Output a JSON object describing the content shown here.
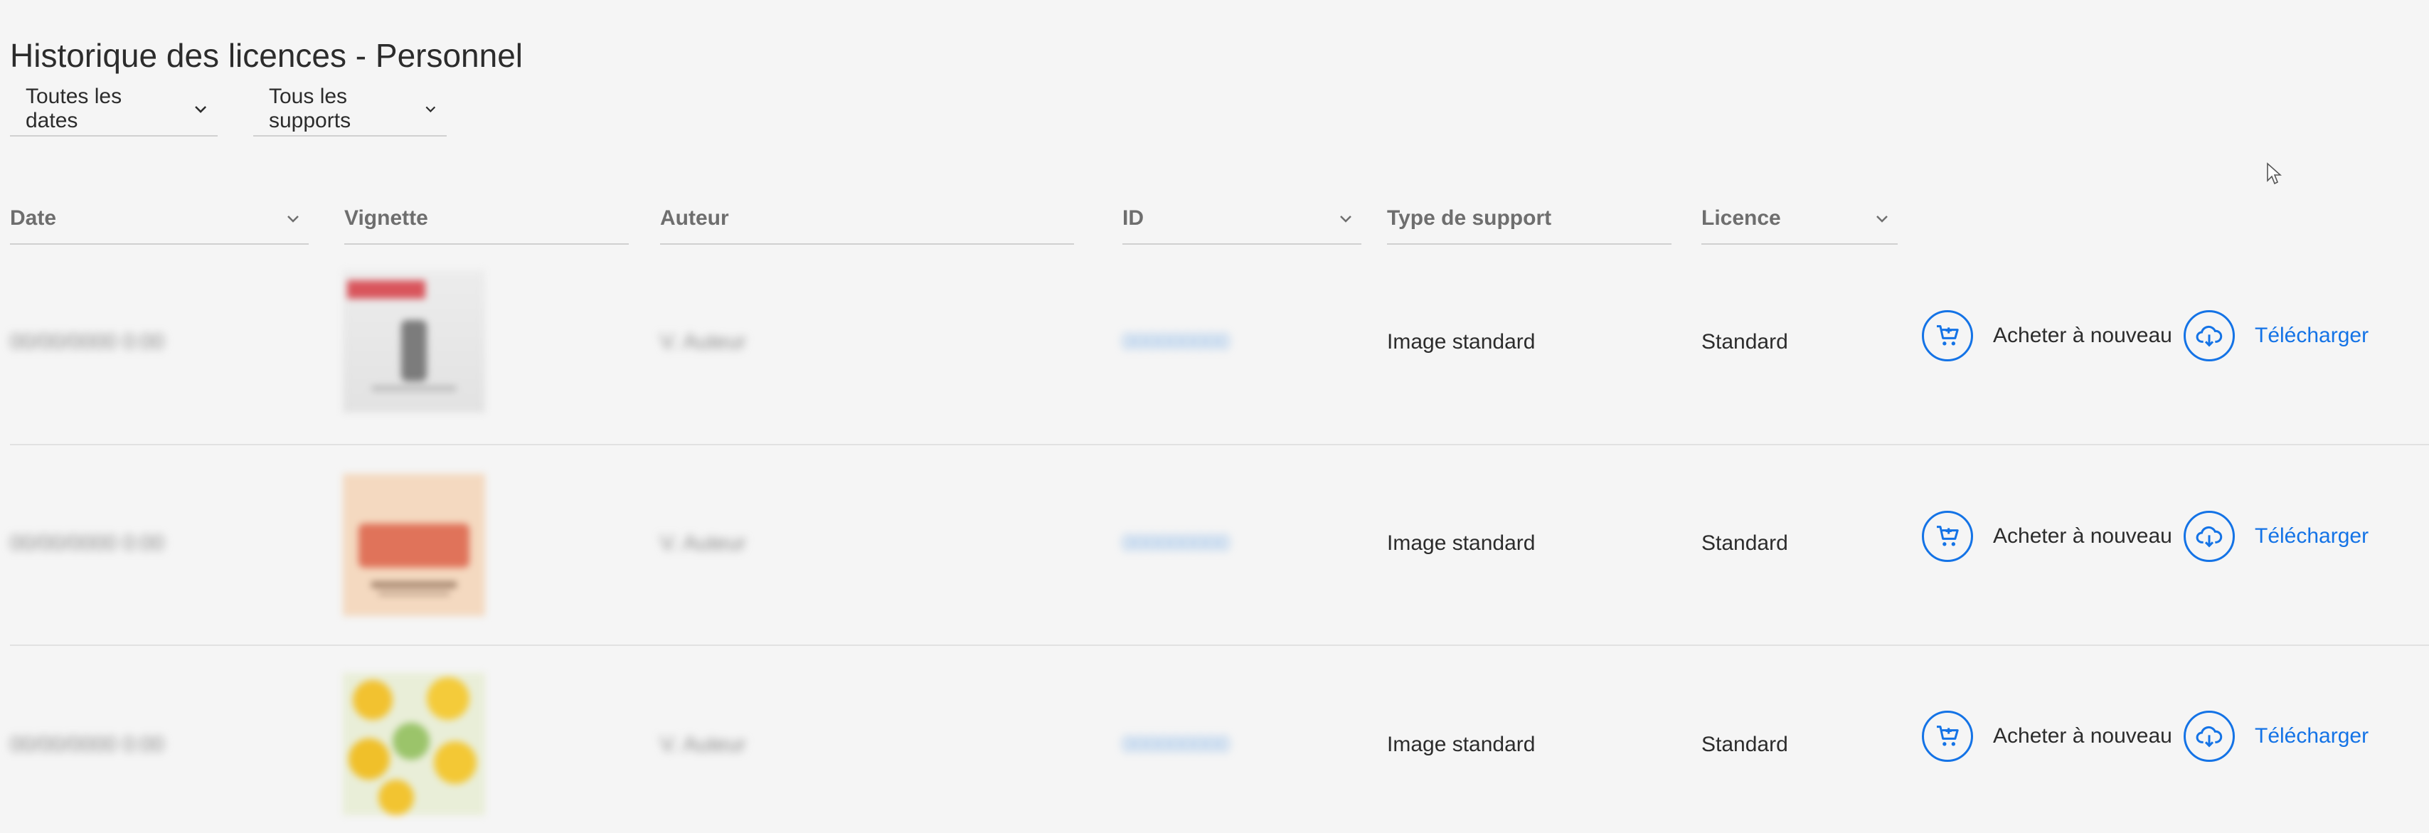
{
  "page": {
    "title": "Historique des licences - Personnel"
  },
  "filters": {
    "dates_label": "Toutes les dates",
    "supports_label": "Tous les supports"
  },
  "table": {
    "columns": {
      "date": "Date",
      "thumbnail": "Vignette",
      "author": "Auteur",
      "id": "ID",
      "media_type": "Type de support",
      "license": "Licence"
    },
    "rows": [
      {
        "date": "00/00/0000 0:00",
        "author": "V. Auteur",
        "id": "000000000",
        "media_type": "Image standard",
        "license": "Standard",
        "thumbnail_icon": "blurred-product-thumbnail"
      },
      {
        "date": "00/00/0000 0:00",
        "author": "V. Auteur",
        "id": "000000000",
        "media_type": "Image standard",
        "license": "Standard",
        "thumbnail_icon": "blurred-text-effect-thumbnail"
      },
      {
        "date": "00/00/0000 0:00",
        "author": "V. Auteur",
        "id": "000000000",
        "media_type": "Image standard",
        "license": "Standard",
        "thumbnail_icon": "blurred-lemons-thumbnail"
      }
    ]
  },
  "actions": {
    "rebuy_label": "Acheter à nouveau",
    "download_label": "Télécharger",
    "rebuy_icon": "cart-add-icon",
    "download_icon": "cloud-download-icon"
  },
  "colors": {
    "accent": "#1473e6",
    "background": "#f5f5f5",
    "divider": "#e1e1e1"
  }
}
